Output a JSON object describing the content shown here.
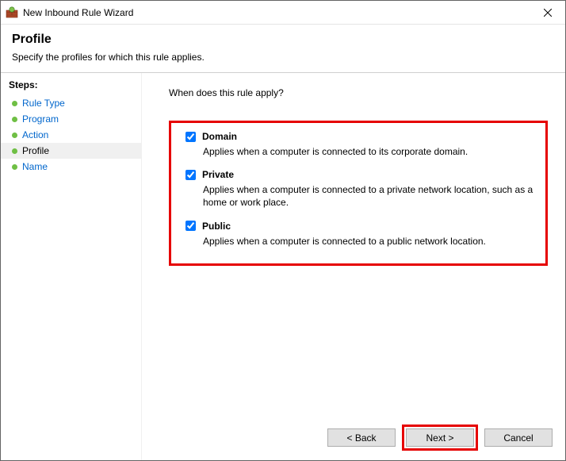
{
  "window": {
    "title": "New Inbound Rule Wizard"
  },
  "header": {
    "title": "Profile",
    "description": "Specify the profiles for which this rule applies."
  },
  "sidebar": {
    "heading": "Steps:",
    "items": [
      {
        "label": "Rule Type",
        "current": false
      },
      {
        "label": "Program",
        "current": false
      },
      {
        "label": "Action",
        "current": false
      },
      {
        "label": "Profile",
        "current": true
      },
      {
        "label": "Name",
        "current": false
      }
    ]
  },
  "main": {
    "question": "When does this rule apply?",
    "options": [
      {
        "key": "domain",
        "label": "Domain",
        "checked": true,
        "description": "Applies when a computer is connected to its corporate domain."
      },
      {
        "key": "private",
        "label": "Private",
        "checked": true,
        "description": "Applies when a computer is connected to a private network location, such as a home or work place."
      },
      {
        "key": "public",
        "label": "Public",
        "checked": true,
        "description": "Applies when a computer is connected to a public network location."
      }
    ]
  },
  "buttons": {
    "back": "< Back",
    "next": "Next >",
    "cancel": "Cancel"
  }
}
